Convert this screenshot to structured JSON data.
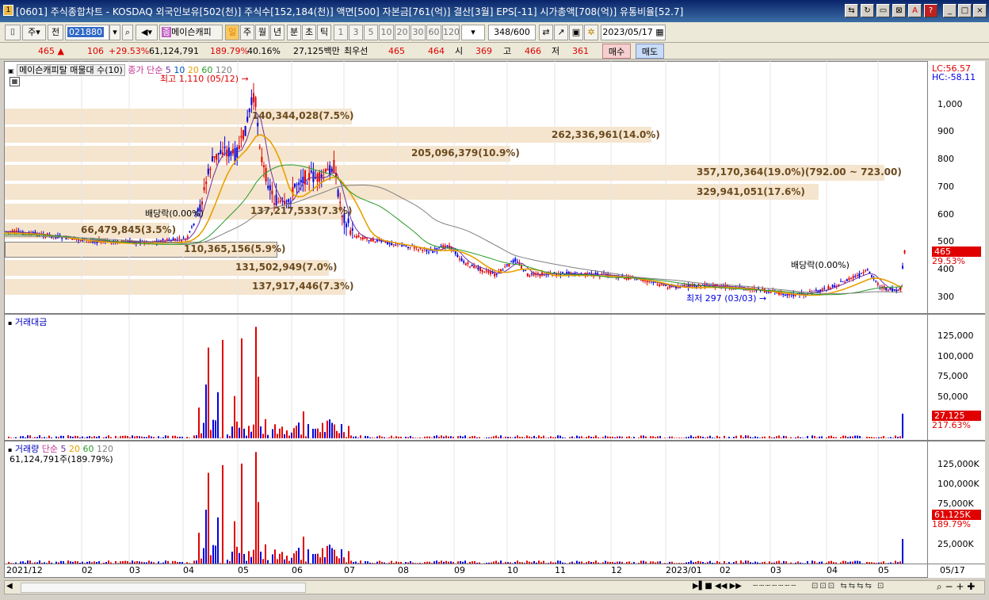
{
  "window": {
    "title": "[0601] 주식종합차트 - KOSDAQ 외국인보유[502(천)] 주식수[152,184(천)] 액면[500] 자본금[761(억)] 결산[3월] EPS[-11] 시가총액[708(억)] 유통비율[52.7]",
    "icon_label": "1",
    "controls": [
      "⇆",
      "↻",
      "▭",
      "⊠",
      "A",
      "?",
      "_",
      "□",
      "×"
    ]
  },
  "toolbar": {
    "type_select": "주",
    "prev_label": "전",
    "code": "021880",
    "stock_name": "메이슨캐피",
    "period_buttons": [
      "일",
      "주",
      "월",
      "년",
      "분",
      "초",
      "틱"
    ],
    "interval_buttons": [
      "1",
      "3",
      "5",
      "10",
      "20",
      "30",
      "60",
      "120"
    ],
    "count": "348",
    "count_total": "/600",
    "date": "2023/05/17"
  },
  "quote": {
    "price": "465",
    "change": "106",
    "change_pct": "+29.53%",
    "volume": "61,124,791",
    "volume_ratio": "189.79%",
    "turnover_pct": "40.16%",
    "trade_value": "27,125백만",
    "best_label": "최우선",
    "best_ask": "465",
    "best_bid": "464",
    "open_label": "시",
    "open": "369",
    "high_label": "고",
    "high": "466",
    "low_label": "저",
    "low": "361",
    "buy_label": "매수",
    "sell_label": "매도"
  },
  "price_panel": {
    "legend_name": "메이슨캐피탈 매물대 수(10)",
    "legend_ma": "종가 단순",
    "ma_periods": [
      "5",
      "10",
      "20",
      "60",
      "120"
    ],
    "lc": "LC:56.57",
    "hc": "HC:-58.11",
    "y_labels": [
      "1,000",
      "900",
      "800",
      "700",
      "600",
      "500",
      "400",
      "300"
    ],
    "current_price": "465",
    "current_pct": "29.53%",
    "high_annot": "최고 1,110 (05/12)",
    "low_annot": "최저 297 (03/03)",
    "dividend1": "배당락(0.00%)",
    "dividend2": "배당락(0.00%)",
    "volume_profile": [
      "140,344,028(7.5%)",
      "262,336,961(14.0%)",
      "205,096,379(10.9%)",
      "357,170,364(19.0%)(792.00 ~ 723.00)",
      "329,941,051(17.6%)",
      "137,217,533(7.3%)",
      "66,479,845(3.5%)",
      "110,365,156(5.9%)",
      "131,502,949(7.0%)",
      "137,917,446(7.3%)"
    ]
  },
  "value_panel": {
    "legend": "거래대금",
    "y_labels": [
      "125,000",
      "100,000",
      "75,000",
      "50,000"
    ],
    "current": "27,125",
    "current_pct": "217.63%"
  },
  "volume_panel": {
    "legend": "거래량",
    "legend_ma": "단순",
    "ma_periods": [
      "5",
      "20",
      "60",
      "120"
    ],
    "sub_legend": "61,124,791주(189.79%)",
    "y_labels": [
      "125,000K",
      "100,000K",
      "75,000K",
      "50,000K",
      "25,000K"
    ],
    "current": "61,125K",
    "current_pct": "189.79%"
  },
  "x_axis": [
    "2021/12",
    "02",
    "03",
    "04",
    "05",
    "06",
    "07",
    "08",
    "09",
    "10",
    "11",
    "12",
    "2023/01",
    "02",
    "03",
    "04",
    "05"
  ],
  "x_axis_end": "05/17",
  "colors": {
    "up": "#e00000",
    "down": "#0000e0",
    "ma5": "#7030a0",
    "ma20": "#e8a000",
    "ma60": "#2a9a2a",
    "ma120": "#808080"
  }
}
